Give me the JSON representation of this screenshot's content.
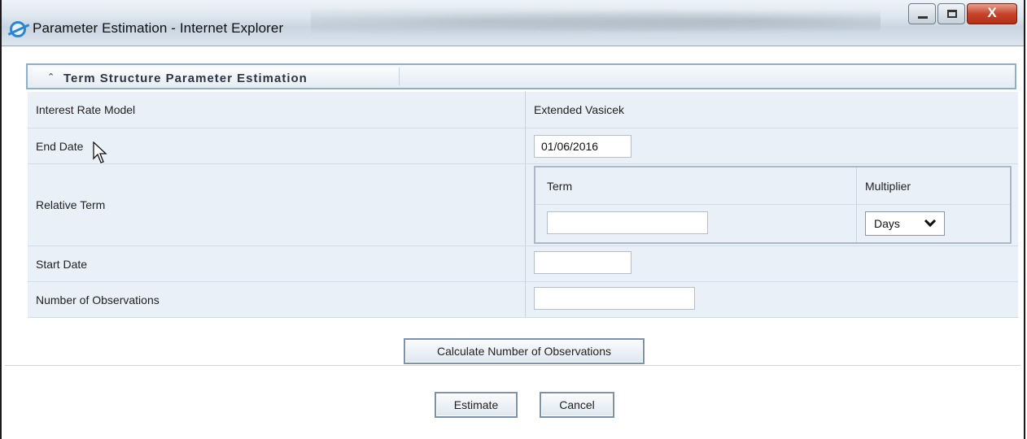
{
  "window": {
    "title": "Parameter Estimation - Internet Explorer",
    "close_label": "X"
  },
  "section": {
    "collapse_glyph": "⌃",
    "title": "Term Structure Parameter Estimation"
  },
  "form": {
    "interest_rate_model_label": "Interest Rate Model",
    "interest_rate_model_value": "Extended Vasicek",
    "end_date_label": "End Date",
    "end_date_value": "01/06/2016",
    "relative_term_label": "Relative Term",
    "term_header": "Term",
    "multiplier_header": "Multiplier",
    "term_value": "",
    "multiplier_value": "Days",
    "start_date_label": "Start Date",
    "start_date_value": "",
    "observations_label": "Number of Observations",
    "observations_value": ""
  },
  "buttons": {
    "calculate": "Calculate Number of Observations",
    "estimate": "Estimate",
    "cancel": "Cancel"
  },
  "icons": {
    "browser": "internet-explorer-icon",
    "collapse": "collapse-icon",
    "dropdown": "chevron-down-icon",
    "cursor": "mouse-pointer-icon"
  },
  "colors": {
    "section_border": "#8eaeca",
    "row_background": "#eaf0f8",
    "close_button": "#c7442a"
  }
}
